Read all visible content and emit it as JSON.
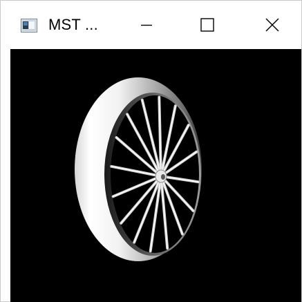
{
  "window": {
    "title": "MST ...",
    "controls": {
      "minimize_icon": "minimize-icon",
      "maximize_icon": "maximize-icon",
      "close_icon": "close-icon"
    }
  },
  "canvas": {
    "background": "#000000",
    "scene": "spoked-wheel",
    "spoke_count": 16
  }
}
